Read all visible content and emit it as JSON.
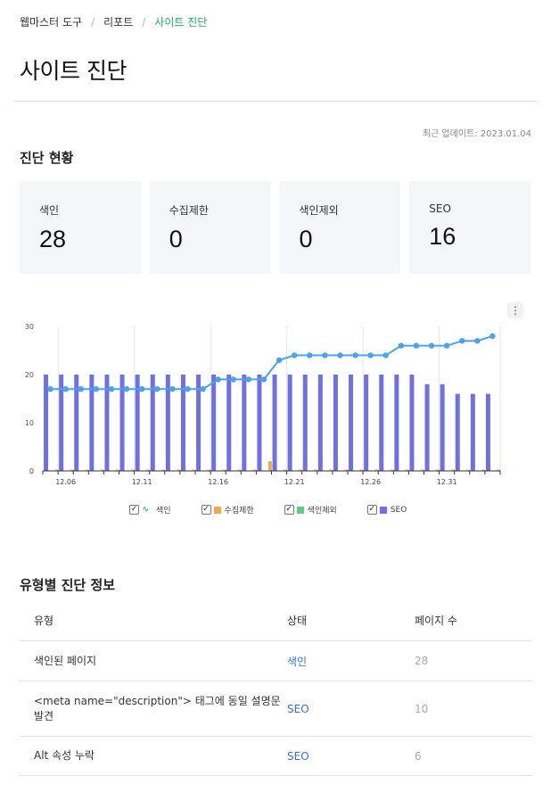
{
  "breadcrumb": {
    "items": [
      "웹마스터 도구",
      "리포트",
      "사이트 진단"
    ]
  },
  "page": {
    "title": "사이트 진단",
    "last_updated": "최근 업데이트: 2023.01.04"
  },
  "status": {
    "title": "진단 현황",
    "cards": [
      {
        "label": "색인",
        "value": "28"
      },
      {
        "label": "수집제한",
        "value": "0"
      },
      {
        "label": "색인제외",
        "value": "0"
      },
      {
        "label": "SEO",
        "value": "16"
      }
    ]
  },
  "chart_menu_icon": "more-vertical-icon",
  "chart_data": {
    "type": "bar",
    "x": [
      "12.05",
      "12.06",
      "12.07",
      "12.08",
      "12.09",
      "12.10",
      "12.11",
      "12.12",
      "12.13",
      "12.14",
      "12.15",
      "12.16",
      "12.17",
      "12.18",
      "12.19",
      "12.20",
      "12.21",
      "12.22",
      "12.23",
      "12.24",
      "12.25",
      "12.26",
      "12.27",
      "12.28",
      "12.29",
      "12.30",
      "12.31",
      "01.01",
      "01.02",
      "01.03"
    ],
    "xticks": [
      "12.06",
      "12.11",
      "12.16",
      "12.21",
      "12.26",
      "12.31"
    ],
    "ylim": [
      0,
      30
    ],
    "yticks": [
      0,
      10,
      20,
      30
    ],
    "grid": "vertical",
    "legend": "bottom",
    "series": [
      {
        "name": "색인",
        "type": "line",
        "color": "#4aa3ee",
        "values": [
          17,
          17,
          17,
          17,
          17,
          17,
          17,
          17,
          17,
          17,
          17,
          19,
          19,
          19,
          19,
          23,
          24,
          24,
          24,
          24,
          24,
          24,
          24,
          26,
          26,
          26,
          26,
          27,
          27,
          28
        ]
      },
      {
        "name": "수집제한",
        "type": "bar",
        "color": "#f5a84a",
        "values": [
          0,
          0,
          0,
          0,
          0,
          0,
          0,
          0,
          0,
          0,
          0,
          0,
          0,
          0,
          2,
          0,
          0,
          0,
          0,
          0,
          0,
          0,
          0,
          0,
          0,
          0,
          0,
          0,
          0,
          0
        ]
      },
      {
        "name": "색인제외",
        "type": "bar",
        "color": "#5ccf7a",
        "values": [
          0,
          0,
          0,
          0,
          0,
          0,
          0,
          0,
          0,
          0,
          0,
          0,
          0,
          0,
          0,
          0,
          0,
          0,
          0,
          0,
          0,
          0,
          0,
          0,
          0,
          0,
          0,
          0,
          0,
          0
        ]
      },
      {
        "name": "SEO",
        "type": "bar",
        "color": "#6f6fe6",
        "values": [
          20,
          20,
          20,
          20,
          20,
          20,
          20,
          20,
          20,
          20,
          20,
          20,
          20,
          20,
          20,
          20,
          20,
          20,
          20,
          20,
          20,
          20,
          20,
          20,
          20,
          18,
          18,
          16,
          16,
          16
        ]
      }
    ]
  },
  "details": {
    "title": "유형별 진단 정보",
    "headers": [
      "유형",
      "상태",
      "페이지 수"
    ],
    "rows": [
      {
        "type": "색인된 페이지",
        "status": "색인",
        "pages": "28"
      },
      {
        "type": "<meta name=\"description\"> 태그에 동일 설명문 발견",
        "status": "SEO",
        "pages": "10"
      },
      {
        "type": "Alt 속성 누락",
        "status": "SEO",
        "pages": "6"
      }
    ]
  }
}
